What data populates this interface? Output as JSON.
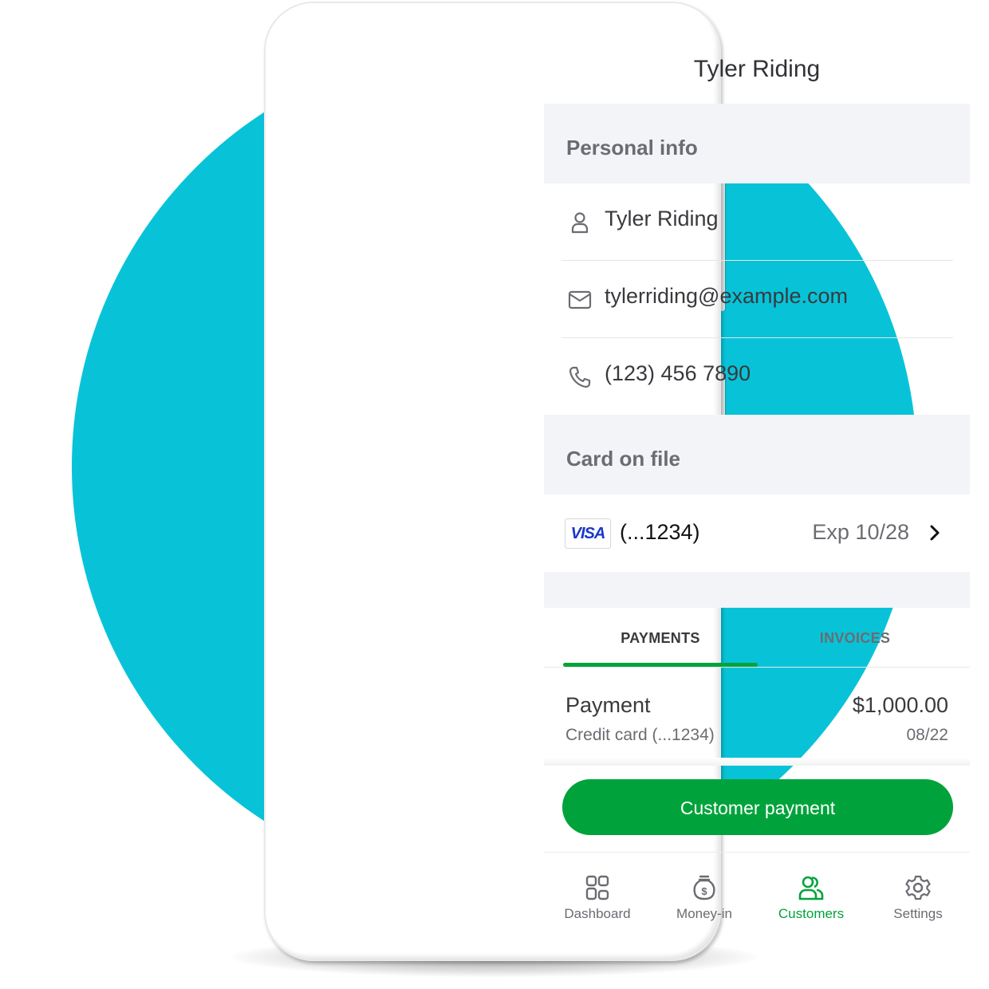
{
  "colors": {
    "accent_green": "#00a33b",
    "background_circle": "#08c3d8",
    "section_bg": "#f3f4f7",
    "text_primary": "#393a3d",
    "text_secondary": "#6b6c72",
    "visa_blue": "#1a37c8"
  },
  "header": {
    "title": "Tyler Riding"
  },
  "personal_info": {
    "heading": "Personal info",
    "rows": [
      {
        "icon": "person-icon",
        "value": "Tyler Riding"
      },
      {
        "icon": "envelope-icon",
        "value": "tylerriding@example.com"
      },
      {
        "icon": "phone-icon",
        "value": "(123) 456 7890"
      }
    ]
  },
  "card_on_file": {
    "heading": "Card on file",
    "brand": "VISA",
    "number": "(...1234)",
    "expiry": "Exp 10/28",
    "chevron_icon": "chevron-right-icon"
  },
  "tabs": [
    {
      "label": "PAYMENTS",
      "active": true
    },
    {
      "label": "INVOICES",
      "active": false
    }
  ],
  "payments": [
    {
      "title": "Payment",
      "method": "Credit card (...1234)",
      "amount": "$1,000.00",
      "date": "08/22"
    }
  ],
  "cta": {
    "label": "Customer payment"
  },
  "bottom_nav": [
    {
      "label": "Dashboard",
      "icon": "dashboard-grid-icon",
      "active": false
    },
    {
      "label": "Money-in",
      "icon": "money-bag-icon",
      "active": false
    },
    {
      "label": "Customers",
      "icon": "customers-icon",
      "active": true
    },
    {
      "label": "Settings",
      "icon": "gear-icon",
      "active": false
    }
  ]
}
